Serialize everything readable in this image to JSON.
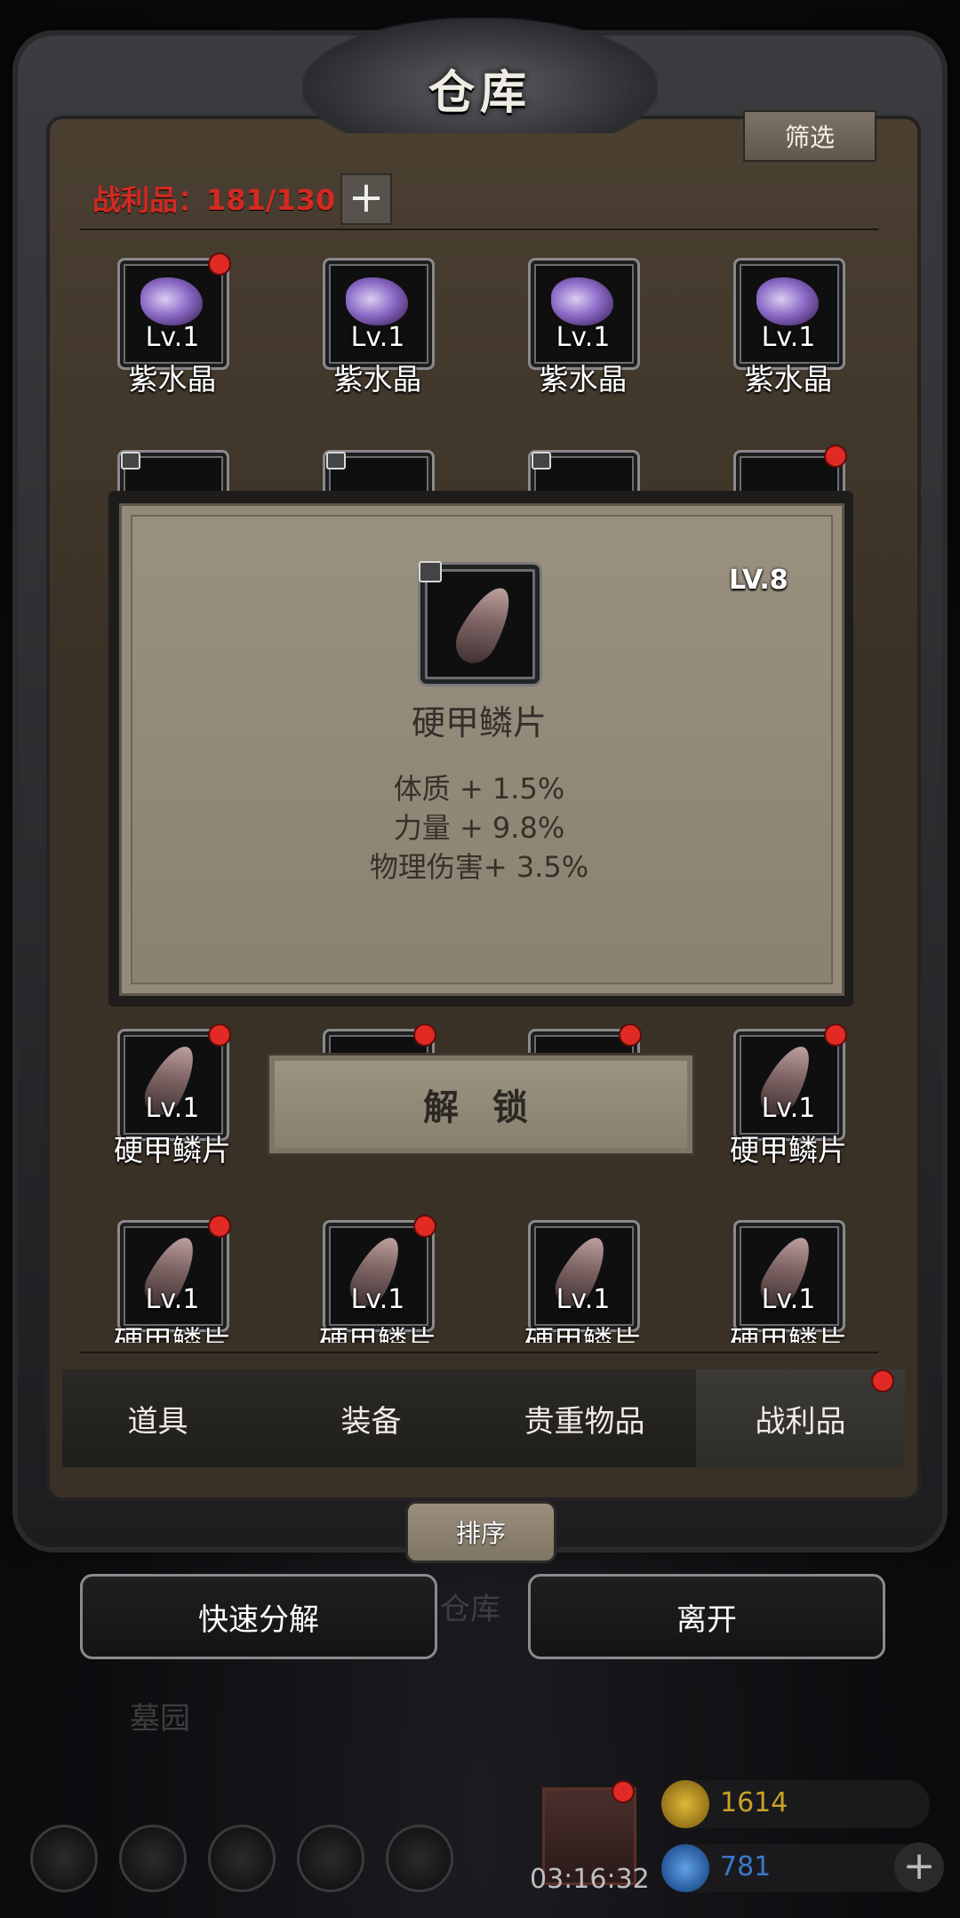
{
  "header": {
    "title": "仓库",
    "filter_label": "筛选"
  },
  "loot": {
    "count_label": "战利品：181/130",
    "add_symbol": "+"
  },
  "grid": {
    "row1": [
      {
        "level": "Lv.1",
        "name": "紫水晶"
      },
      {
        "level": "Lv.1",
        "name": "紫水晶"
      },
      {
        "level": "Lv.1",
        "name": "紫水晶"
      },
      {
        "level": "Lv.1",
        "name": "紫水晶"
      }
    ],
    "row4": [
      {
        "level": "Lv.1",
        "name": "硬甲鳞片"
      },
      {
        "level": "Lv.1",
        "name": "硬甲鳞片"
      }
    ],
    "row5": [
      {
        "level": "Lv.1",
        "name": "硬甲鳞片"
      },
      {
        "level": "Lv.1",
        "name": "硬甲鳞片"
      },
      {
        "level": "Lv.1",
        "name": "硬甲鳞片"
      },
      {
        "level": "Lv.1",
        "name": "硬甲鳞片"
      }
    ]
  },
  "popup": {
    "level": "LV.8",
    "name": "硬甲鳞片",
    "stats": [
      "体质 + 1.5%",
      "力量 + 9.8%",
      "物理伤害+ 3.5%"
    ],
    "unlock_label": "解 锁"
  },
  "tabs": [
    "道具",
    "装备",
    "贵重物品",
    "战利品"
  ],
  "sort_label": "排序",
  "actions": {
    "quick_decompose": "快速分解",
    "leave": "离开"
  },
  "background": {
    "warehouse": "仓库",
    "cemetery": "墓园"
  },
  "hud": {
    "gold": "1614",
    "gems": "781",
    "timer": "03:16:32",
    "add_symbol": "+",
    "colors": {
      "gold": "#c9a227",
      "gem": "#3b78c9"
    }
  }
}
